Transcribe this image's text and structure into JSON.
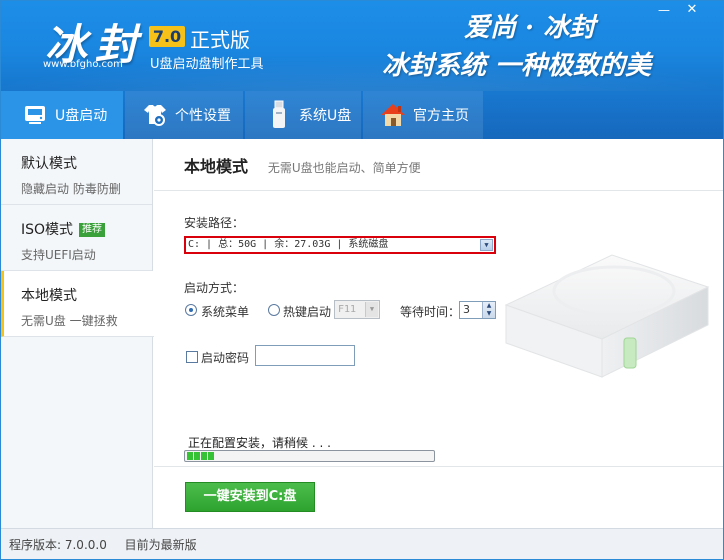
{
  "header": {
    "logo": "冰封",
    "url": "www.bfgho.com",
    "version": "7.0",
    "edition": "正式版",
    "subtitle": "U盘启动盘制作工具",
    "slogan_line1": "爱尚 · 冰封",
    "slogan_line2": "冰封系统 一种极致的美",
    "minimize": "—",
    "close": "✕"
  },
  "tabs": [
    {
      "label": "U盘启动",
      "icon": "usb-drive-icon",
      "active": true
    },
    {
      "label": "个性设置",
      "icon": "tshirt-gear-icon",
      "active": false
    },
    {
      "label": "系统U盘",
      "icon": "usb-stick-icon",
      "active": false
    },
    {
      "label": "官方主页",
      "icon": "home-icon",
      "active": false
    }
  ],
  "sidebar": {
    "items": [
      {
        "title": "默认模式",
        "sub": "隐藏启动 防毒防删",
        "badge": ""
      },
      {
        "title": "ISO模式",
        "sub": "支持UEFI启动",
        "badge": "推荐"
      },
      {
        "title": "本地模式",
        "sub": "无需U盘 一键拯救",
        "badge": ""
      }
    ]
  },
  "main": {
    "title": "本地模式",
    "description": "无需U盘也能启动、简单方便",
    "install_path_label": "安装路径：",
    "install_path_value": "C: | 总：50G | 余：27.03G | 系统磁盘",
    "boot_mode_label": "启动方式：",
    "boot_options": [
      "系统菜单",
      "热键启动"
    ],
    "boot_selected": "系统菜单",
    "hotkey_value": "F11",
    "wait_label": "等待时间：",
    "wait_value": "3",
    "password_label": "启动密码",
    "password_checked": false,
    "status_text": "正在配置安装，请稍候 . . .",
    "progress_blocks": 4,
    "install_button": "一键安装到C:盘"
  },
  "footer": {
    "version_text": "程序版本: 7.0.0.0",
    "latest_text": "目前为最新版"
  },
  "colors": {
    "header_blue": "#1a86e0",
    "accent_yellow": "#f6c21a",
    "green": "#2ea32e",
    "highlight_red": "#d9000c"
  }
}
